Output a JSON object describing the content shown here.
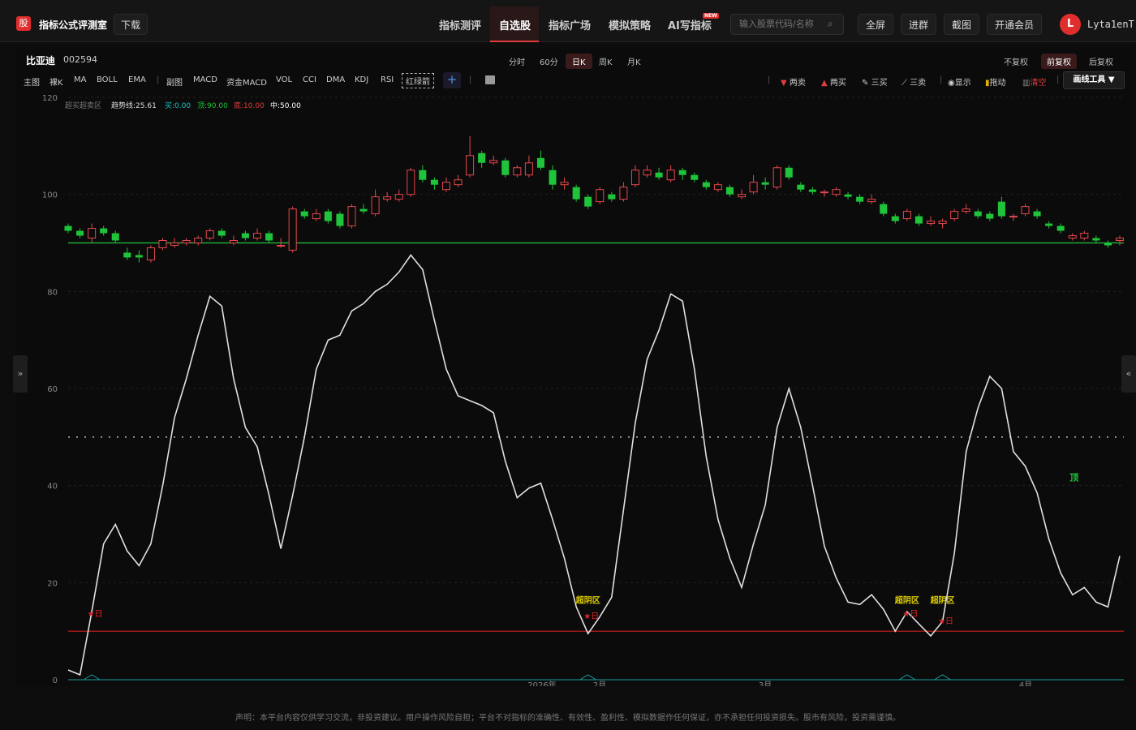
{
  "header": {
    "logo_char": "股",
    "brand": "指标公式评测室",
    "download": "下载",
    "nav": [
      "指标测评",
      "自选股",
      "指标广场",
      "模拟策略",
      "AI写指标"
    ],
    "new_badge": "NEW",
    "search_placeholder": "输入股票代码/名称",
    "actions": [
      "全屏",
      "进群",
      "截图",
      "开通会员"
    ],
    "avatar_letter": "L",
    "username": "Lyta1enT"
  },
  "stock": {
    "name": "比亚迪",
    "code": "002594"
  },
  "periods": [
    "分时",
    "60分",
    "日K",
    "周K",
    "月K"
  ],
  "adjust": [
    "不复权",
    "前复权",
    "后复权"
  ],
  "indicators": [
    "主图",
    "裸K",
    "MA",
    "BOLL",
    "EMA",
    "副图",
    "MACD",
    "资金MACD",
    "VOL",
    "CCI",
    "DMA",
    "KDJ",
    "RSI",
    "红绿箭"
  ],
  "tools": [
    "两卖",
    "两买",
    "三买",
    "三卖",
    "显示",
    "拖动",
    "清空"
  ],
  "draw_tools": "画线工具 ▼",
  "legend": {
    "label": "超买超卖区",
    "trend": "趋势线:25.61",
    "buy": "买:0.00",
    "top": "顶:90.00",
    "bottom": "底:10.00",
    "mid": "中:50.00"
  },
  "disclaimer": "声明：本平台内容仅供学习交流，非投资建议。用户操作风险自担；平台不对指标的准确性、有效性、盈利性、模拟数据作任何保证，亦不承担任何投资损失。股市有风险，投资需谨慎。",
  "colors": {
    "up": "#e5474c",
    "down": "#1fc43a",
    "line": "#e0e0e0",
    "bottom_line": "#cc1f1f",
    "top_line": "#1fc43a",
    "bg": "#0b0b0b"
  },
  "chart_data": {
    "type": "candlestick+line",
    "ylim": [
      0,
      120
    ],
    "yticks": [
      0,
      20,
      40,
      60,
      80,
      100,
      120
    ],
    "xlabels": [
      "2026年",
      "2月",
      "3月",
      "4月"
    ],
    "candles": [
      [
        93.5,
        92.5,
        94,
        92
      ],
      [
        92.5,
        91.5,
        93,
        91
      ],
      [
        91,
        93,
        94,
        90
      ],
      [
        93,
        92,
        93.5,
        91.5
      ],
      [
        92,
        90.5,
        92.5,
        90
      ],
      [
        88,
        87,
        89,
        86.5
      ],
      [
        87.5,
        87,
        88.5,
        86
      ],
      [
        86.5,
        89,
        89.5,
        86
      ],
      [
        89,
        90.5,
        91,
        88.5
      ],
      [
        89.5,
        90,
        91,
        89
      ],
      [
        90,
        90.5,
        91,
        89.5
      ],
      [
        90,
        91,
        91.5,
        89.5
      ],
      [
        91,
        92.5,
        93,
        90.5
      ],
      [
        92.5,
        91.5,
        93,
        91
      ],
      [
        90,
        90.5,
        91.5,
        89.5
      ],
      [
        92,
        91,
        92.5,
        90.5
      ],
      [
        91,
        92,
        93,
        90.5
      ],
      [
        92,
        90.5,
        92.5,
        90
      ],
      [
        89.5,
        89.5,
        91,
        89
      ],
      [
        88.5,
        97,
        97.5,
        88
      ],
      [
        96.5,
        95.5,
        97,
        95
      ],
      [
        95,
        96,
        97,
        94.5
      ],
      [
        96.5,
        94.5,
        97,
        94
      ],
      [
        96,
        93.5,
        96.5,
        93
      ],
      [
        93.5,
        97.5,
        98,
        93
      ],
      [
        97,
        96.5,
        98,
        96
      ],
      [
        96,
        99.5,
        101,
        95.5
      ],
      [
        99,
        99.5,
        100.5,
        98.5
      ],
      [
        99,
        100,
        101,
        98.5
      ],
      [
        100,
        105,
        105.5,
        99.5
      ],
      [
        105,
        103,
        106,
        102.5
      ],
      [
        103,
        102,
        103.5,
        101
      ],
      [
        101,
        102.5,
        103.5,
        100.5
      ],
      [
        102,
        103,
        104,
        101.5
      ],
      [
        104,
        108,
        112,
        103.5
      ],
      [
        108.5,
        106.5,
        109,
        105.5
      ],
      [
        106.5,
        107,
        108,
        106
      ],
      [
        107,
        104,
        107.5,
        103.5
      ],
      [
        104,
        105.5,
        106,
        103.5
      ],
      [
        104,
        106.5,
        108,
        103.5
      ],
      [
        107.5,
        105.5,
        109,
        105
      ],
      [
        105,
        102,
        106,
        101
      ],
      [
        102,
        102.5,
        103.5,
        101
      ],
      [
        101.5,
        99,
        102,
        98.5
      ],
      [
        99.5,
        97.5,
        100,
        97
      ],
      [
        98.5,
        101,
        101.5,
        98
      ],
      [
        100,
        99,
        100.5,
        98.5
      ],
      [
        99,
        101.5,
        102.5,
        98.5
      ],
      [
        102,
        105,
        106,
        101.5
      ],
      [
        104,
        105,
        106,
        103.5
      ],
      [
        104.5,
        103.5,
        105.5,
        103
      ],
      [
        103,
        105,
        106,
        102.5
      ],
      [
        105,
        104,
        105.5,
        103
      ],
      [
        104,
        103,
        104.5,
        102.5
      ],
      [
        102.5,
        101.5,
        103,
        101
      ],
      [
        101,
        102,
        102.5,
        100.5
      ],
      [
        101.5,
        100,
        102,
        99.5
      ],
      [
        99.5,
        100,
        101,
        99
      ],
      [
        100.5,
        102.5,
        104,
        100
      ],
      [
        102.5,
        102,
        103.5,
        101
      ],
      [
        101.5,
        105.5,
        106,
        101
      ],
      [
        105.5,
        103.5,
        106,
        103
      ],
      [
        102,
        101,
        102.5,
        100.5
      ],
      [
        101,
        100.5,
        101.5,
        100
      ],
      [
        100.5,
        100.5,
        101,
        99.5
      ],
      [
        100,
        101,
        101.5,
        99.5
      ],
      [
        100,
        99.5,
        100.5,
        99
      ],
      [
        99.5,
        98.5,
        100,
        98
      ],
      [
        98.5,
        99,
        100,
        98
      ],
      [
        98,
        96,
        98.5,
        95.5
      ],
      [
        95.5,
        94.5,
        96,
        94
      ],
      [
        95,
        96.5,
        97,
        94.5
      ],
      [
        95.5,
        94,
        96,
        93.5
      ],
      [
        94,
        94.5,
        95.5,
        93.5
      ],
      [
        94,
        94.5,
        95,
        93
      ],
      [
        95,
        96.5,
        97,
        94.5
      ],
      [
        96.5,
        97,
        98,
        96
      ],
      [
        96.5,
        95.5,
        97,
        95
      ],
      [
        96,
        95,
        96.5,
        94.5
      ],
      [
        98.5,
        95.5,
        99.5,
        95
      ],
      [
        95.5,
        95.5,
        96,
        94.5
      ],
      [
        96,
        97.5,
        98,
        95.5
      ],
      [
        96.5,
        95.5,
        97,
        95
      ],
      [
        94,
        93.5,
        94.5,
        93
      ],
      [
        93.5,
        92.5,
        94,
        92
      ],
      [
        91,
        91.5,
        92,
        90.5
      ],
      [
        91,
        92,
        92.5,
        90.5
      ],
      [
        91,
        90.5,
        91.5,
        90
      ],
      [
        90,
        89.5,
        90.5,
        89
      ],
      [
        90.5,
        91,
        91.5,
        89.5
      ]
    ],
    "line": [
      2,
      1,
      14,
      28,
      32,
      26.5,
      23.5,
      28,
      40,
      54,
      62,
      71,
      79,
      77,
      62,
      52,
      48,
      38,
      27,
      38,
      50,
      64,
      70,
      71,
      76,
      77.5,
      80,
      81.5,
      84,
      87.5,
      84.5,
      74,
      64,
      58.5,
      57.5,
      56.5,
      55,
      45,
      37.5,
      39.5,
      40.5,
      33,
      25,
      15,
      9.5,
      13,
      17,
      35,
      53,
      66,
      72,
      79.5,
      78,
      64,
      46,
      33,
      25,
      19,
      28,
      36,
      52,
      60,
      52,
      40,
      27.5,
      21,
      16,
      15.5,
      17.5,
      14.5,
      10,
      14,
      11.5,
      9,
      12,
      26,
      47,
      56,
      62.5,
      60,
      47,
      44,
      38.5,
      29,
      22,
      17.5,
      19,
      16,
      15,
      25.5
    ],
    "top_line": 90,
    "bottom_line": 10,
    "mid_line": 50,
    "signals_bottom": [
      {
        "i": 2,
        "y": 13,
        "label": "★日"
      },
      {
        "i": 44,
        "y": 12.5,
        "label": "★日"
      },
      {
        "i": 71,
        "y": 13,
        "label": "★日"
      },
      {
        "i": 74,
        "y": 11.5,
        "label": "★日"
      }
    ],
    "zone_labels": [
      {
        "i": 44,
        "y": 15.8,
        "label": "超阴区"
      },
      {
        "i": 71,
        "y": 15.8,
        "label": "超阴区"
      },
      {
        "i": 74,
        "y": 15.8,
        "label": "超阴区"
      }
    ],
    "top_label": {
      "i": 85,
      "y": 41,
      "label": "顶"
    }
  }
}
